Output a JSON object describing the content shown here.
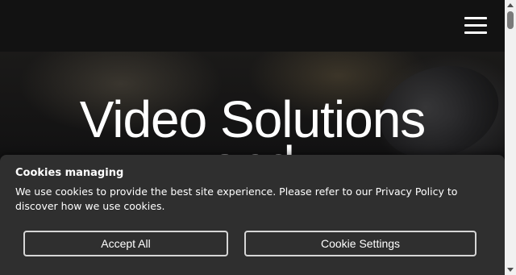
{
  "header": {
    "menu_icon": "hamburger-menu-icon"
  },
  "hero": {
    "title_line1": "Video Solutions",
    "title_line2": "and"
  },
  "cookie_banner": {
    "title": "Cookies managing",
    "message": "We use cookies to provide the best site experience. Please refer to our Privacy Policy to discover how we use cookies.",
    "accept_label": "Accept All",
    "settings_label": "Cookie Settings"
  },
  "colors": {
    "background": "#111111",
    "banner": "#2f2f2f",
    "text": "#ffffff",
    "button_border": "#d6d6d6"
  }
}
